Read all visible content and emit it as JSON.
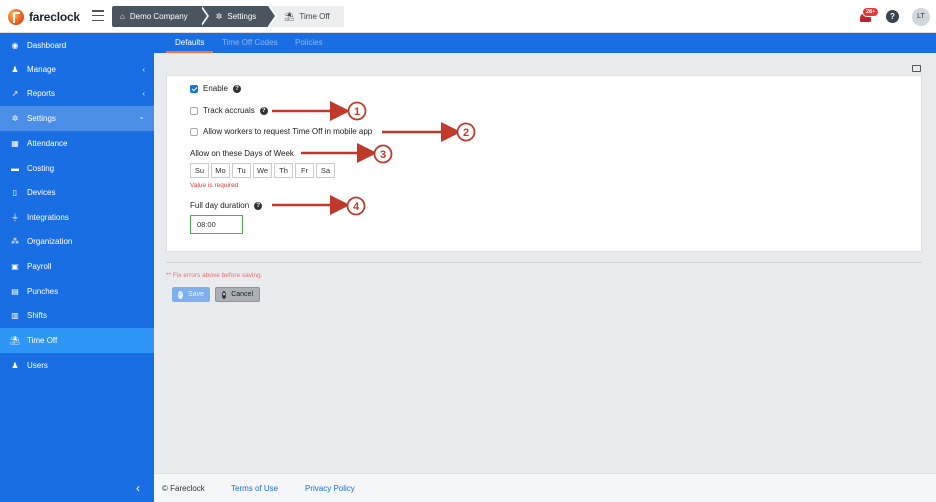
{
  "brand": {
    "name": "fareclock"
  },
  "breadcrumb": {
    "items": [
      "Demo Company",
      "Settings",
      "Time Off"
    ]
  },
  "header": {
    "notification_count": "28+",
    "help_label": "?",
    "avatar_initials": "LT"
  },
  "sidebar": {
    "items": [
      {
        "label": "Dashboard",
        "icon": "dashboard-icon"
      },
      {
        "label": "Manage",
        "icon": "person-icon",
        "chevron": "‹"
      },
      {
        "label": "Reports",
        "icon": "chart-icon",
        "chevron": "‹"
      },
      {
        "label": "Settings",
        "icon": "gear-icon",
        "chevron": "⌄"
      },
      {
        "label": "Attendance",
        "icon": "table-icon"
      },
      {
        "label": "Costing",
        "icon": "bar-chart-icon"
      },
      {
        "label": "Devices",
        "icon": "device-icon"
      },
      {
        "label": "Integrations",
        "icon": "plug-icon"
      },
      {
        "label": "Organization",
        "icon": "sitemap-icon"
      },
      {
        "label": "Payroll",
        "icon": "money-icon"
      },
      {
        "label": "Punches",
        "icon": "punch-icon"
      },
      {
        "label": "Shifts",
        "icon": "clipboard-icon"
      },
      {
        "label": "Time Off",
        "icon": "beach-icon"
      },
      {
        "label": "Users",
        "icon": "users-icon"
      }
    ],
    "collapse_label": "‹"
  },
  "tabs": [
    {
      "label": "Defaults",
      "active": true
    },
    {
      "label": "Time Off Codes",
      "active": false
    },
    {
      "label": "Policies",
      "active": false
    }
  ],
  "form": {
    "enable": {
      "label": "Enable",
      "checked": true
    },
    "track_accruals": {
      "label": "Track accruals",
      "checked": false
    },
    "allow_mobile": {
      "label": "Allow workers to request Time Off in mobile app",
      "checked": false
    },
    "days": {
      "label": "Allow on these Days of Week",
      "options": [
        "Su",
        "Mo",
        "Tu",
        "We",
        "Th",
        "Fr",
        "Sa"
      ],
      "error": "Value is required"
    },
    "duration": {
      "label": "Full day duration",
      "value": "08:00"
    },
    "fix_errors": "** Fix errors above before saving.",
    "save_label": "Save",
    "cancel_label": "Cancel"
  },
  "annotations": [
    "1",
    "2",
    "3",
    "4"
  ],
  "footer": {
    "copyright": "© Fareclock",
    "terms": "Terms of Use",
    "privacy": "Privacy Policy"
  },
  "colors": {
    "sidebar": "#1a6ee3",
    "active_item": "#2d96f7",
    "arrow": "#c0392b",
    "error": "#e53935"
  }
}
